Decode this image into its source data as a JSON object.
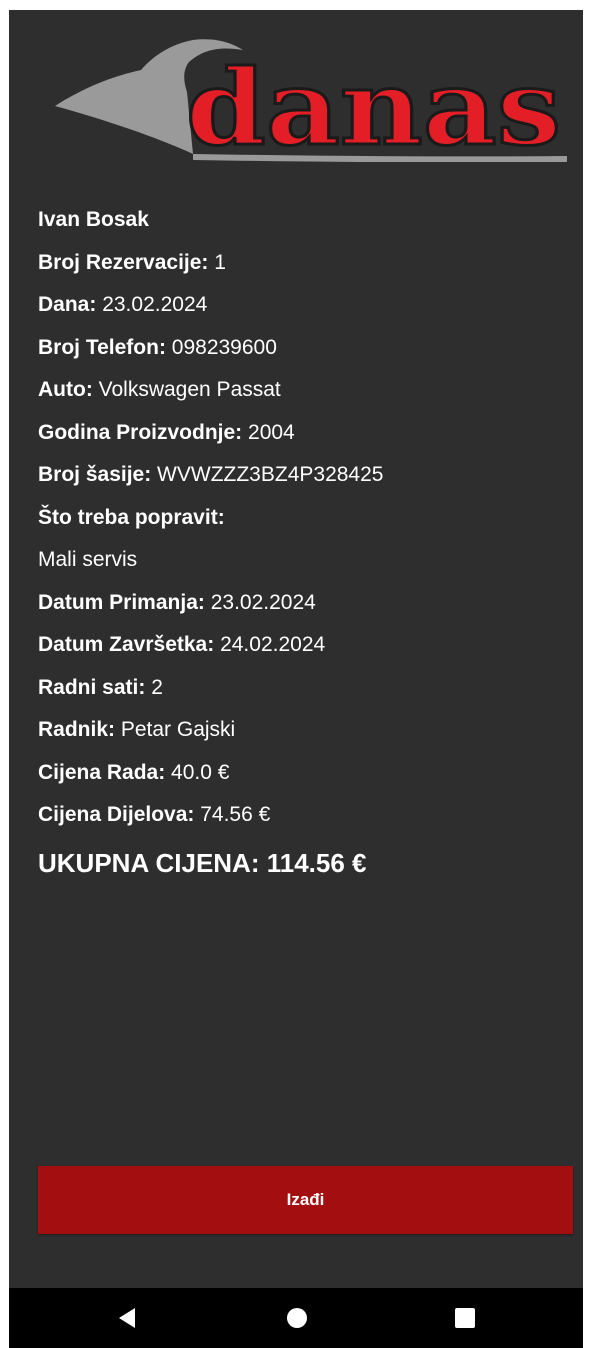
{
  "logo": {
    "text": "danas",
    "colors": {
      "letters": "#e31e26",
      "outline": "#1a1a1a",
      "swoosh": "#9a9a9a"
    }
  },
  "details": {
    "customer_name": "Ivan Bosak",
    "reservation_number": {
      "label": "Broj Rezervacije:",
      "value": " 1"
    },
    "date": {
      "label": "Dana:",
      "value": "  23.02.2024"
    },
    "phone": {
      "label": "Broj Telefon:",
      "value": "  098239600"
    },
    "car": {
      "label": "Auto:",
      "value": " Volkswagen Passat"
    },
    "production_year": {
      "label": "Godina Proizvodnje:",
      "value": "  2004"
    },
    "chassis_number": {
      "label": "Broj šasije:",
      "value": "  WVWZZZ3BZ4P328425"
    },
    "repair_needed": {
      "label": "Što treba popravit:",
      "value": "Mali servis"
    },
    "received_date": {
      "label": "Datum Primanja:",
      "value": " 23.02.2024"
    },
    "completion_date": {
      "label": "Datum Završetka:",
      "value": "  24.02.2024"
    },
    "work_hours": {
      "label": "Radni sati:",
      "value": " 2"
    },
    "worker": {
      "label": "Radnik:",
      "value": " Petar Gajski"
    },
    "labor_price": {
      "label": "Cijena Rada:",
      "value": " 40.0 €"
    },
    "parts_price": {
      "label": "Cijena Dijelova:",
      "value": "  74.56 €"
    },
    "total_price": {
      "label": "UKUPNA CIJENA:",
      "value": "  114.56 €"
    }
  },
  "exit_button": {
    "label": "Izađi",
    "color": "#a30f10"
  },
  "navbar": {
    "back_icon": "triangle-back-icon",
    "home_icon": "circle-home-icon",
    "recent_icon": "square-recent-icon"
  },
  "colors": {
    "background": "#2e2e2e",
    "text": "#ffffff"
  }
}
